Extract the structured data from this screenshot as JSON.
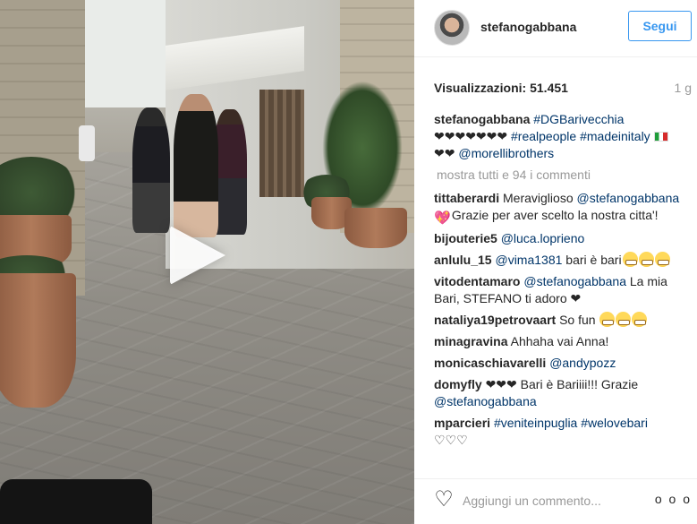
{
  "post": {
    "username": "stefanogabbana",
    "follow_label": "Segui",
    "views_label": "Visualizzazioni:",
    "views_count": "51.451",
    "time_ago": "1 g"
  },
  "caption": {
    "user": "stefanogabbana",
    "tag1": "#DGBarivecchia",
    "hearts": "❤❤❤❤❤❤❤",
    "tag2": "#realpeople",
    "tag3": "#madeinitaly",
    "hearts2": "❤❤",
    "mention": "@morellibrothers"
  },
  "show_all": "mostra tutti e 94 i commenti",
  "comments": [
    {
      "user": "tittaberardi",
      "pre": "Meraviglioso",
      "mention": "@stefanogabbana",
      "post": "Grazie per aver scelto la nostra citta'!"
    },
    {
      "user": "bijouterie5",
      "mention": "@luca.loprieno"
    },
    {
      "user": "anlulu_15",
      "mention": "@vima1381",
      "post": "bari è bari"
    },
    {
      "user": "vitodentamaro",
      "mention": "@stefanogabbana",
      "post": "La mia Bari, STEFANO ti adoro ❤"
    },
    {
      "user": "nataliya19petrovaart",
      "post": "So fun"
    },
    {
      "user": "minagravina",
      "post": "Ahhaha vai Anna!"
    },
    {
      "user": "monicaschiavarelli",
      "mention": "@andypozz"
    },
    {
      "user": "domyfly",
      "pre": "❤❤❤ Bari è Bariiii!!! Grazie",
      "mention": "@stefanogabbana"
    },
    {
      "user": "mparcieri",
      "tag1": "#veniteinpuglia",
      "tag2": "#welovebari",
      "post": "♡♡♡"
    }
  ],
  "footer": {
    "placeholder": "Aggiungi un commento...",
    "options": "o o o"
  }
}
